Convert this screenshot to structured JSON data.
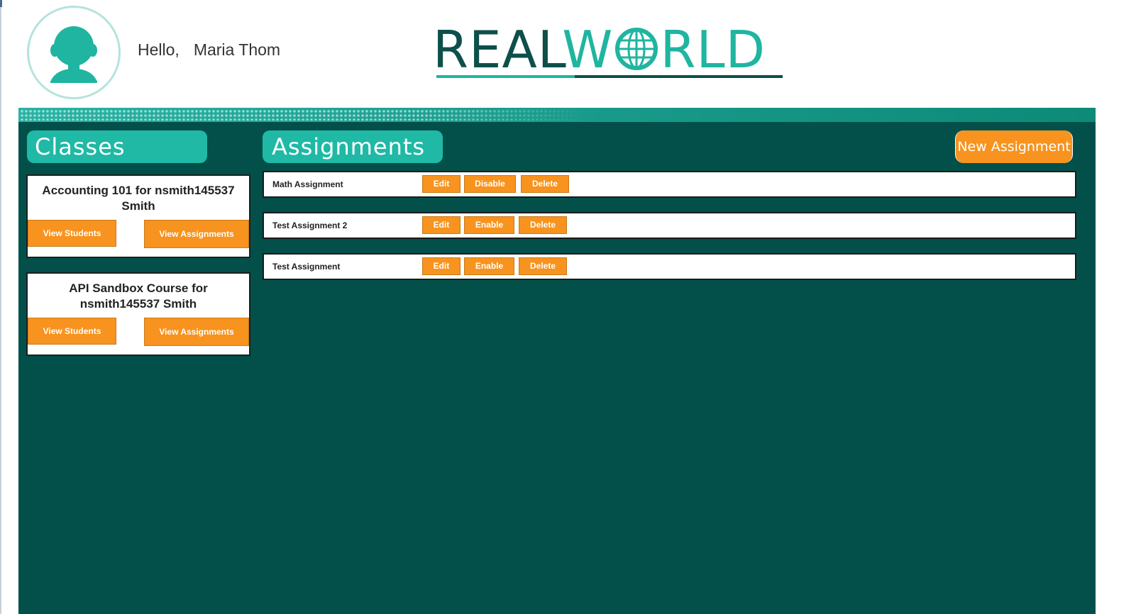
{
  "header": {
    "greeting": "Hello,",
    "user_name": "Maria Thom",
    "logo": {
      "part1": "REAL",
      "part2_prefix": "W",
      "part2_suffix": "RLD",
      "colors": {
        "dark": "#0e4f4a",
        "accent": "#1fb5a0"
      }
    },
    "avatar_icon": "user-silhouette-icon"
  },
  "classes": {
    "title": "Classes",
    "items": [
      {
        "name": "Accounting 101 for nsmith145537 Smith",
        "view_students_label": "View Students",
        "view_assignments_label": "View Assignments"
      },
      {
        "name": "API Sandbox Course for nsmith145537 Smith",
        "view_students_label": "View Students",
        "view_assignments_label": "View Assignments"
      }
    ]
  },
  "assignments": {
    "title": "Assignments",
    "new_button_label": "New Assignment",
    "items": [
      {
        "name": "Math Assignment",
        "edit_label": "Edit",
        "toggle_label": "Disable",
        "delete_label": "Delete"
      },
      {
        "name": "Test Assignment 2",
        "edit_label": "Edit",
        "toggle_label": "Enable",
        "delete_label": "Delete"
      },
      {
        "name": "Test Assignment",
        "edit_label": "Edit",
        "toggle_label": "Enable",
        "delete_label": "Delete"
      }
    ]
  },
  "colors": {
    "panel_bg": "#03504b",
    "header_teal": "#1fb9a6",
    "button_orange": "#f7931e"
  }
}
